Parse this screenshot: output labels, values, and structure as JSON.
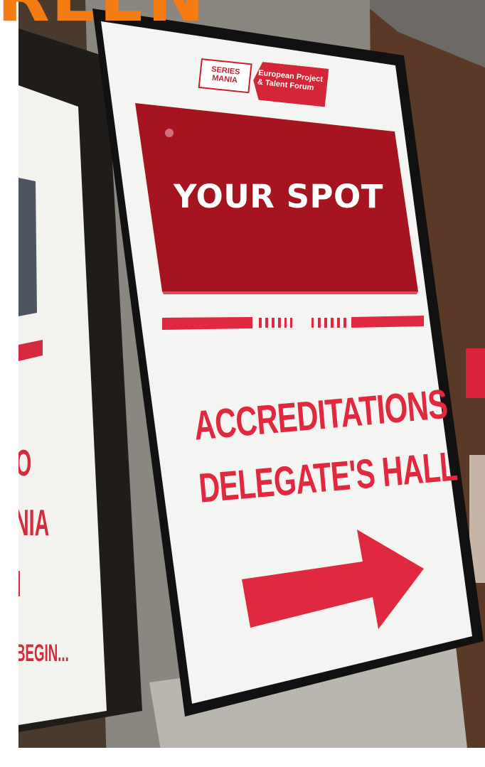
{
  "headline": "REEN",
  "logo": {
    "series_line1": "SERIES",
    "series_line2": "MANIA",
    "forum_line1": "European Project",
    "forum_line2": "& Talent Forum"
  },
  "screen": {
    "spot_label": "YOUR SPOT"
  },
  "sign": {
    "line1": "ACCREDITATIONS",
    "line2": "DELEGATE'S HALL",
    "arrow": "arrow-right-icon"
  },
  "left_panel": {
    "line1": "O",
    "line2": "NIA",
    "line3": "I",
    "line4": "BEGIN..."
  },
  "colors": {
    "headline": "#f47c12",
    "sign_red": "#e0283e",
    "screen_red": "#a6141f",
    "panel_white": "#f2f2ef"
  }
}
